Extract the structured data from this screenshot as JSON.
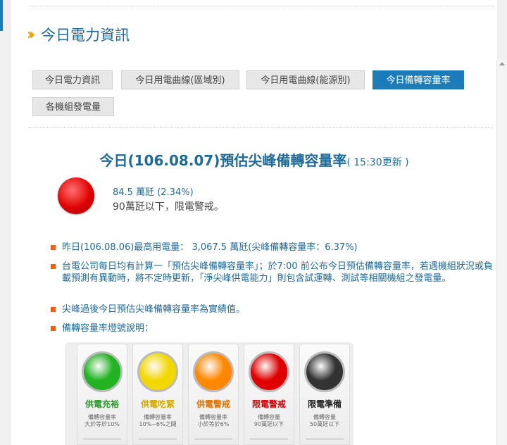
{
  "heading": "今日電力資訊",
  "tabs": [
    {
      "label": "今日電力資訊",
      "active": false
    },
    {
      "label": "今日用電曲線(區域別)",
      "active": false
    },
    {
      "label": "今日用電曲線(能源別)",
      "active": false
    },
    {
      "label": "今日備轉容量率",
      "active": true
    },
    {
      "label": "各機組發電量",
      "active": false
    }
  ],
  "title": {
    "main": "今日(106.08.07)預估尖峰備轉容量率",
    "update": "( 15:30更新 )"
  },
  "status": {
    "line1": "84.5 萬瓩 (2.34%)",
    "line2": "90萬瓩以下，限電警戒。",
    "lamp_color": "#e00000"
  },
  "bullets": [
    "昨日(106.08.06)最高用電量： 3,067.5 萬瓩(尖峰備轉容量率：6.37%)",
    "台電公司每日均有計算一「預估尖峰備轉容量率」；於7:00 前公布今日預估備轉容量率，若遇機組狀況或負載預測有異動時，將不定時更新，「淨尖峰供電能力」則包含試運轉、測試等相關機組之發電量。",
    "尖峰過後今日預估尖峰備轉容量率為實績值。",
    "備轉容量率燈號說明："
  ],
  "legend": [
    {
      "name": "供電充裕",
      "d1": "備轉容量率",
      "d2": "大於等於10%",
      "color": "#22b322",
      "text_color": "#2a9a2a"
    },
    {
      "name": "供電吃緊",
      "d1": "備轉容量率",
      "d2": "10%~6%之間",
      "color": "#f2d800",
      "text_color": "#d4a800"
    },
    {
      "name": "供電警戒",
      "d1": "備轉容量率",
      "d2": "小於等於6%",
      "color": "#ff8800",
      "text_color": "#e07000"
    },
    {
      "name": "限電警戒",
      "d1": "備轉容量",
      "d2": "90萬瓩以下",
      "color": "#e00000",
      "text_color": "#d00000"
    },
    {
      "name": "限電準備",
      "d1": "備轉容量",
      "d2": "50萬瓩以下",
      "color": "#333333",
      "text_color": "#222222"
    }
  ]
}
